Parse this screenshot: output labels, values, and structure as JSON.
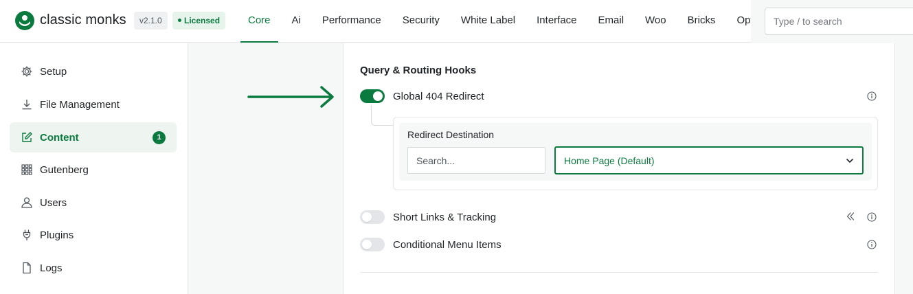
{
  "header": {
    "brand": "classic monks",
    "version": "v2.1.0",
    "license": "Licensed",
    "tabs": [
      {
        "label": "Core",
        "active": true
      },
      {
        "label": "Ai"
      },
      {
        "label": "Performance"
      },
      {
        "label": "Security"
      },
      {
        "label": "White Label"
      },
      {
        "label": "Interface"
      },
      {
        "label": "Email"
      },
      {
        "label": "Woo"
      },
      {
        "label": "Bricks"
      },
      {
        "label": "Opt"
      }
    ],
    "search_placeholder": "Type / to search"
  },
  "sidebar": {
    "items": [
      {
        "label": "Setup",
        "icon": "gear-icon"
      },
      {
        "label": "File Management",
        "icon": "download-icon"
      },
      {
        "label": "Content",
        "icon": "edit-icon",
        "active": true,
        "badge": "1"
      },
      {
        "label": "Gutenberg",
        "icon": "grid-icon"
      },
      {
        "label": "Users",
        "icon": "user-icon"
      },
      {
        "label": "Plugins",
        "icon": "plug-icon"
      },
      {
        "label": "Logs",
        "icon": "file-icon"
      }
    ]
  },
  "main": {
    "section_title": "Query & Routing Hooks",
    "settings": [
      {
        "label": "Global 404 Redirect",
        "enabled": true
      },
      {
        "label": "Short Links & Tracking",
        "enabled": false
      },
      {
        "label": "Conditional Menu Items",
        "enabled": false
      }
    ],
    "redirect": {
      "title": "Redirect Destination",
      "search_placeholder": "Search...",
      "selected": "Home Page (Default)"
    }
  },
  "colors": {
    "accent": "#0a7a3e",
    "accent_light": "#eef5f0",
    "border": "#e3e5e8",
    "background": "#f6f7f7"
  }
}
